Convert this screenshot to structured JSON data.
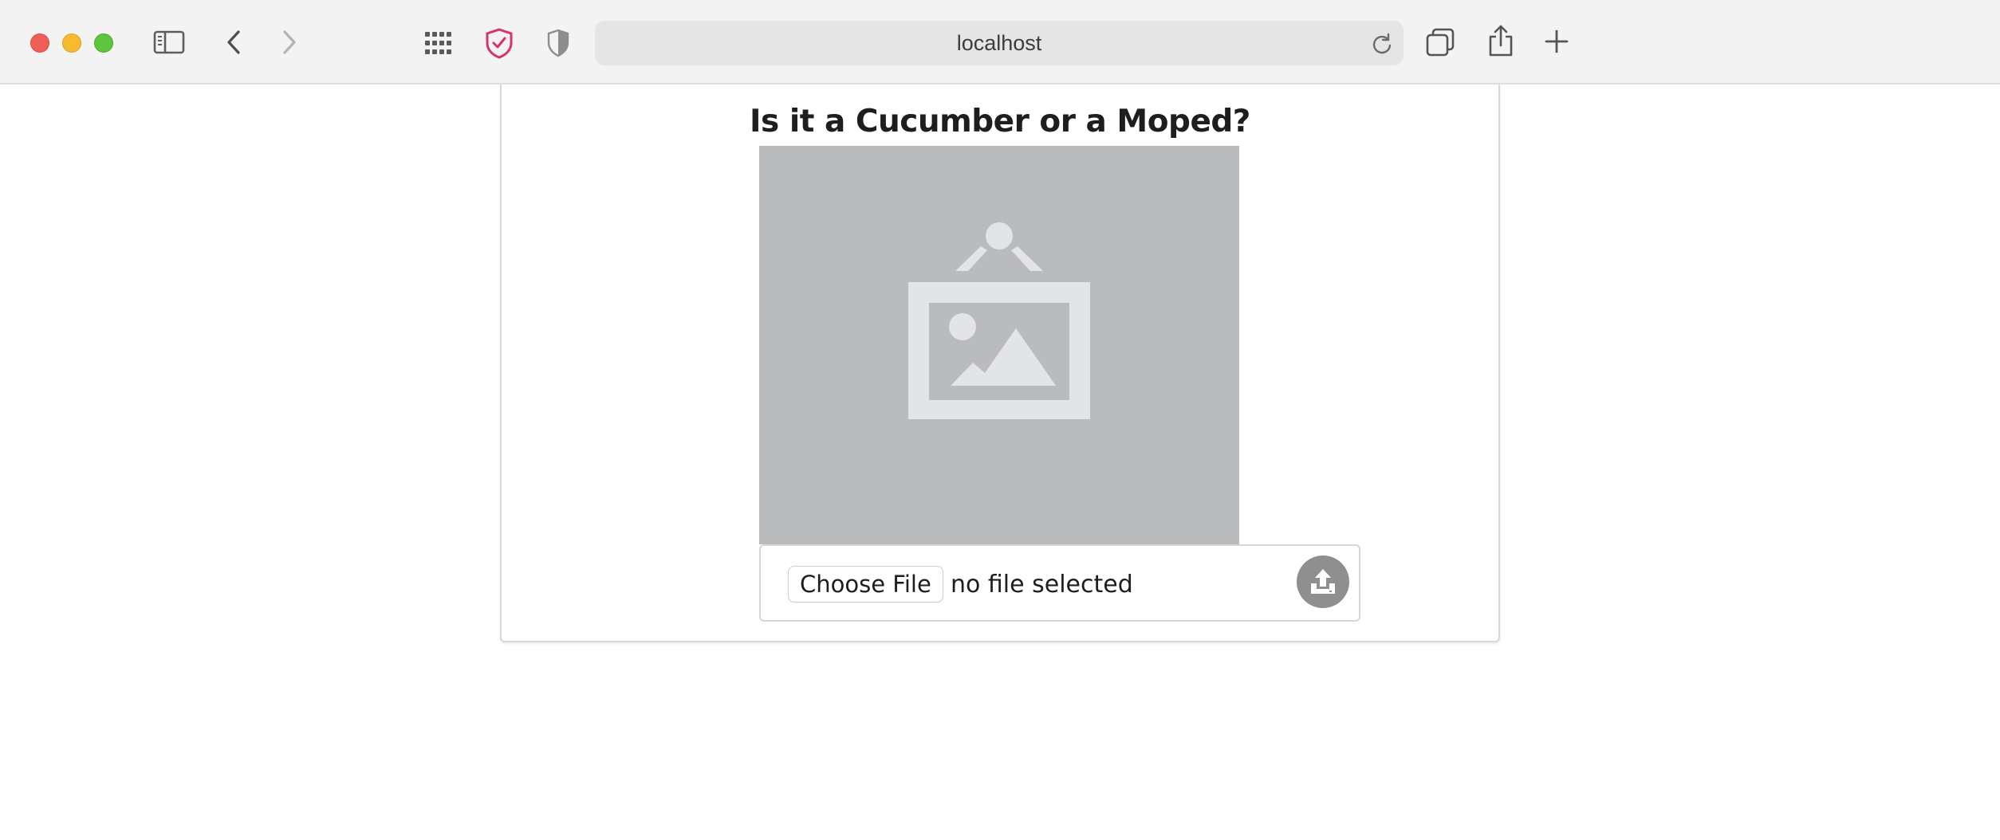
{
  "browser": {
    "address": "localhost",
    "icons": {
      "sidebar": "sidebar-icon",
      "back": "chevron-left-icon",
      "forward": "chevron-right-icon",
      "grid": "grid-icon",
      "shield_check": "shield-check-icon",
      "shield_half": "shield-half-icon",
      "reload": "reload-icon",
      "tabs": "tabs-overview-icon",
      "share": "share-icon",
      "new_tab": "plus-icon"
    },
    "colors": {
      "close": "#ee5f57",
      "minimize": "#f5bc2f",
      "zoom": "#5fc53f",
      "shield_accent": "#d6336c"
    }
  },
  "page": {
    "title": "Is it a Cucumber or a Moped?",
    "preview_icon": "image-placeholder-icon",
    "upload": {
      "choose_label": "Choose File",
      "status": "no file selected",
      "upload_icon": "upload-icon",
      "upload_color": "#8f8f8f"
    }
  }
}
